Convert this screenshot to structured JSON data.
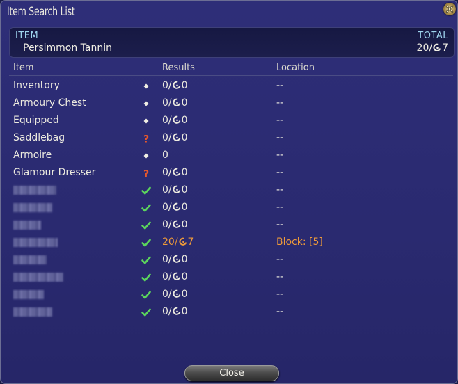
{
  "window": {
    "title": "Item Search List",
    "close_icon": "close-x-icon"
  },
  "header": {
    "item_caption": "ITEM",
    "item_name": "Persimmon Tannin",
    "total_caption": "TOTAL",
    "total_count": "20/",
    "total_hq_count": "7"
  },
  "columns": {
    "item": "Item",
    "results": "Results",
    "location": "Location"
  },
  "rows": [
    {
      "name": "Inventory",
      "status": "diamond",
      "count": "0/",
      "hq": "0",
      "location": "--"
    },
    {
      "name": "Armoury Chest",
      "status": "diamond",
      "count": "0/",
      "hq": "0",
      "location": "--"
    },
    {
      "name": "Equipped",
      "status": "diamond",
      "count": "0/",
      "hq": "0",
      "location": "--"
    },
    {
      "name": "Saddlebag",
      "status": "question",
      "count": "0/",
      "hq": "0",
      "location": "--"
    },
    {
      "name": "Armoire",
      "status": "diamond",
      "count": "0",
      "hq": "",
      "location": "--"
    },
    {
      "name": "Glamour Dresser",
      "status": "question",
      "count": "0/",
      "hq": "0",
      "location": "--"
    },
    {
      "name": "",
      "status": "check",
      "count": "0/",
      "hq": "0",
      "location": "--"
    },
    {
      "name": "",
      "status": "check",
      "count": "0/",
      "hq": "0",
      "location": "--"
    },
    {
      "name": "",
      "status": "check",
      "count": "0/",
      "hq": "0",
      "location": "--"
    },
    {
      "name": "",
      "status": "check",
      "count": "20/",
      "hq": "7",
      "location": "Block:  [5]",
      "highlight": true
    },
    {
      "name": "",
      "status": "check",
      "count": "0/",
      "hq": "0",
      "location": "--"
    },
    {
      "name": "",
      "status": "check",
      "count": "0/",
      "hq": "0",
      "location": "--"
    },
    {
      "name": "",
      "status": "check",
      "count": "0/",
      "hq": "0",
      "location": "--"
    },
    {
      "name": "",
      "status": "check",
      "count": "0/",
      "hq": "0",
      "location": "--"
    }
  ],
  "close_button": "Close",
  "colors": {
    "header_caption": "#9fd4ee",
    "highlight": "#ee9a3a",
    "check": "#5cd65c",
    "question": "#e8582c"
  }
}
